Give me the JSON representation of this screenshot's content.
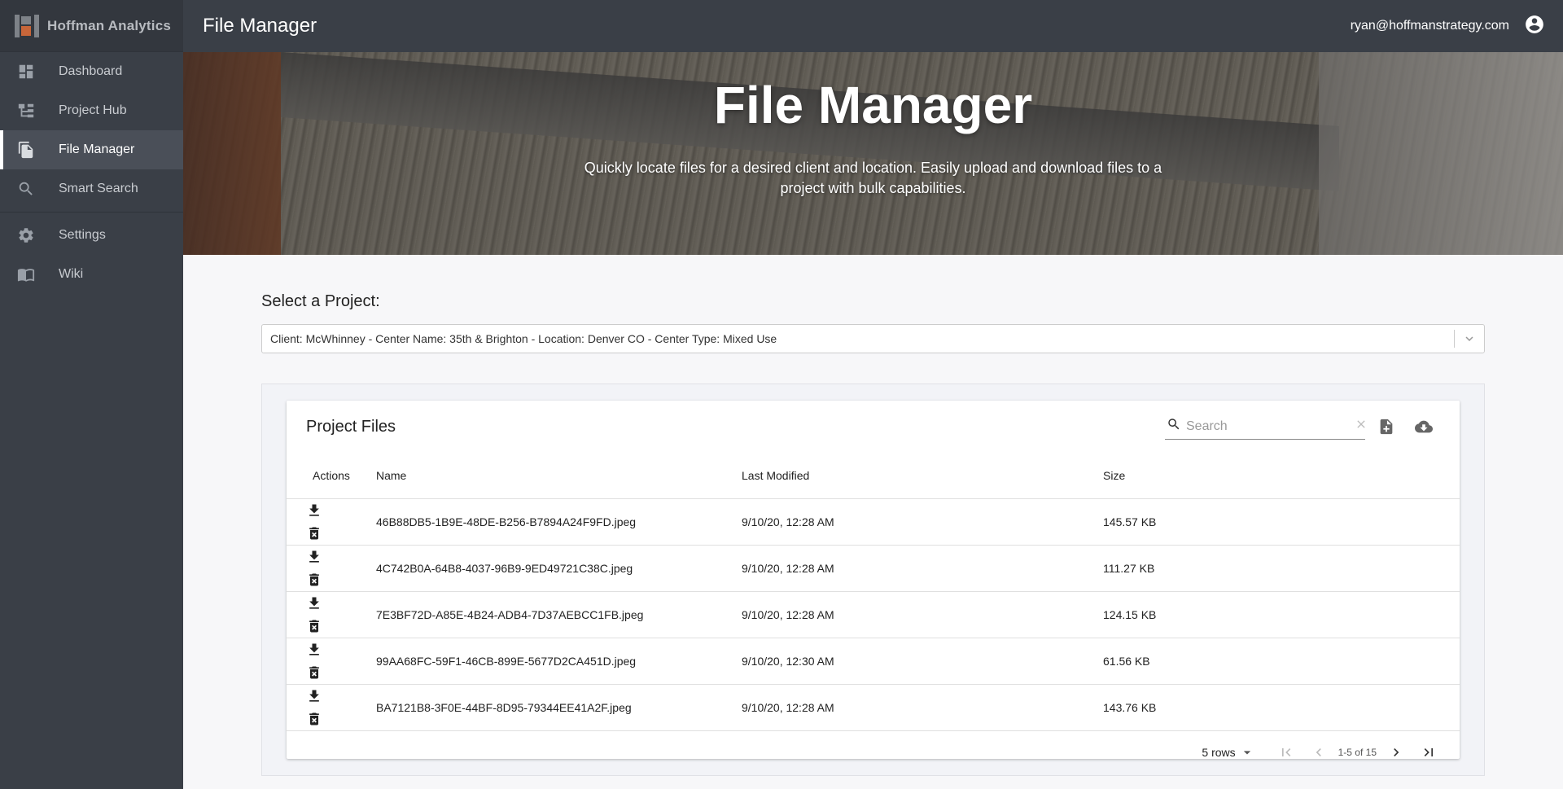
{
  "app": {
    "brand": "Hoffman Analytics"
  },
  "sidebar": {
    "items": [
      {
        "label": "Dashboard",
        "icon": "dashboard-icon"
      },
      {
        "label": "Project Hub",
        "icon": "hub-icon"
      },
      {
        "label": "File Manager",
        "icon": "file-copy-icon",
        "active": true
      },
      {
        "label": "Smart Search",
        "icon": "search-icon"
      },
      {
        "label": "Settings",
        "icon": "gear-icon"
      },
      {
        "label": "Wiki",
        "icon": "book-icon"
      }
    ]
  },
  "topbar": {
    "title": "File Manager",
    "user_email": "ryan@hoffmanstrategy.com"
  },
  "hero": {
    "title": "File Manager",
    "subtitle": "Quickly locate files for a desired client and location. Easily upload and download files to a project with bulk capabilities."
  },
  "project_select": {
    "label": "Select a Project:",
    "value": "Client: McWhinney - Center Name: 35th & Brighton - Location: Denver CO - Center Type: Mixed Use"
  },
  "files_table": {
    "title": "Project Files",
    "search_placeholder": "Search",
    "columns": [
      "Actions",
      "Name",
      "Last Modified",
      "Size"
    ],
    "rows": [
      {
        "name": "46B88DB5-1B9E-48DE-B256-B7894A24F9FD.jpeg",
        "modified": "9/10/20, 12:28 AM",
        "size": "145.57 KB"
      },
      {
        "name": "4C742B0A-64B8-4037-96B9-9ED49721C38C.jpeg",
        "modified": "9/10/20, 12:28 AM",
        "size": "111.27 KB"
      },
      {
        "name": "7E3BF72D-A85E-4B24-ADB4-7D37AEBCC1FB.jpeg",
        "modified": "9/10/20, 12:28 AM",
        "size": "124.15 KB"
      },
      {
        "name": "99AA68FC-59F1-46CB-899E-5677D2CA451D.jpeg",
        "modified": "9/10/20, 12:30 AM",
        "size": "61.56 KB"
      },
      {
        "name": "BA7121B8-3F0E-44BF-8D95-79344EE41A2F.jpeg",
        "modified": "9/10/20, 12:28 AM",
        "size": "143.76 KB"
      }
    ],
    "pagination": {
      "rows_label": "5 rows",
      "range": "1-5 of 15"
    }
  }
}
